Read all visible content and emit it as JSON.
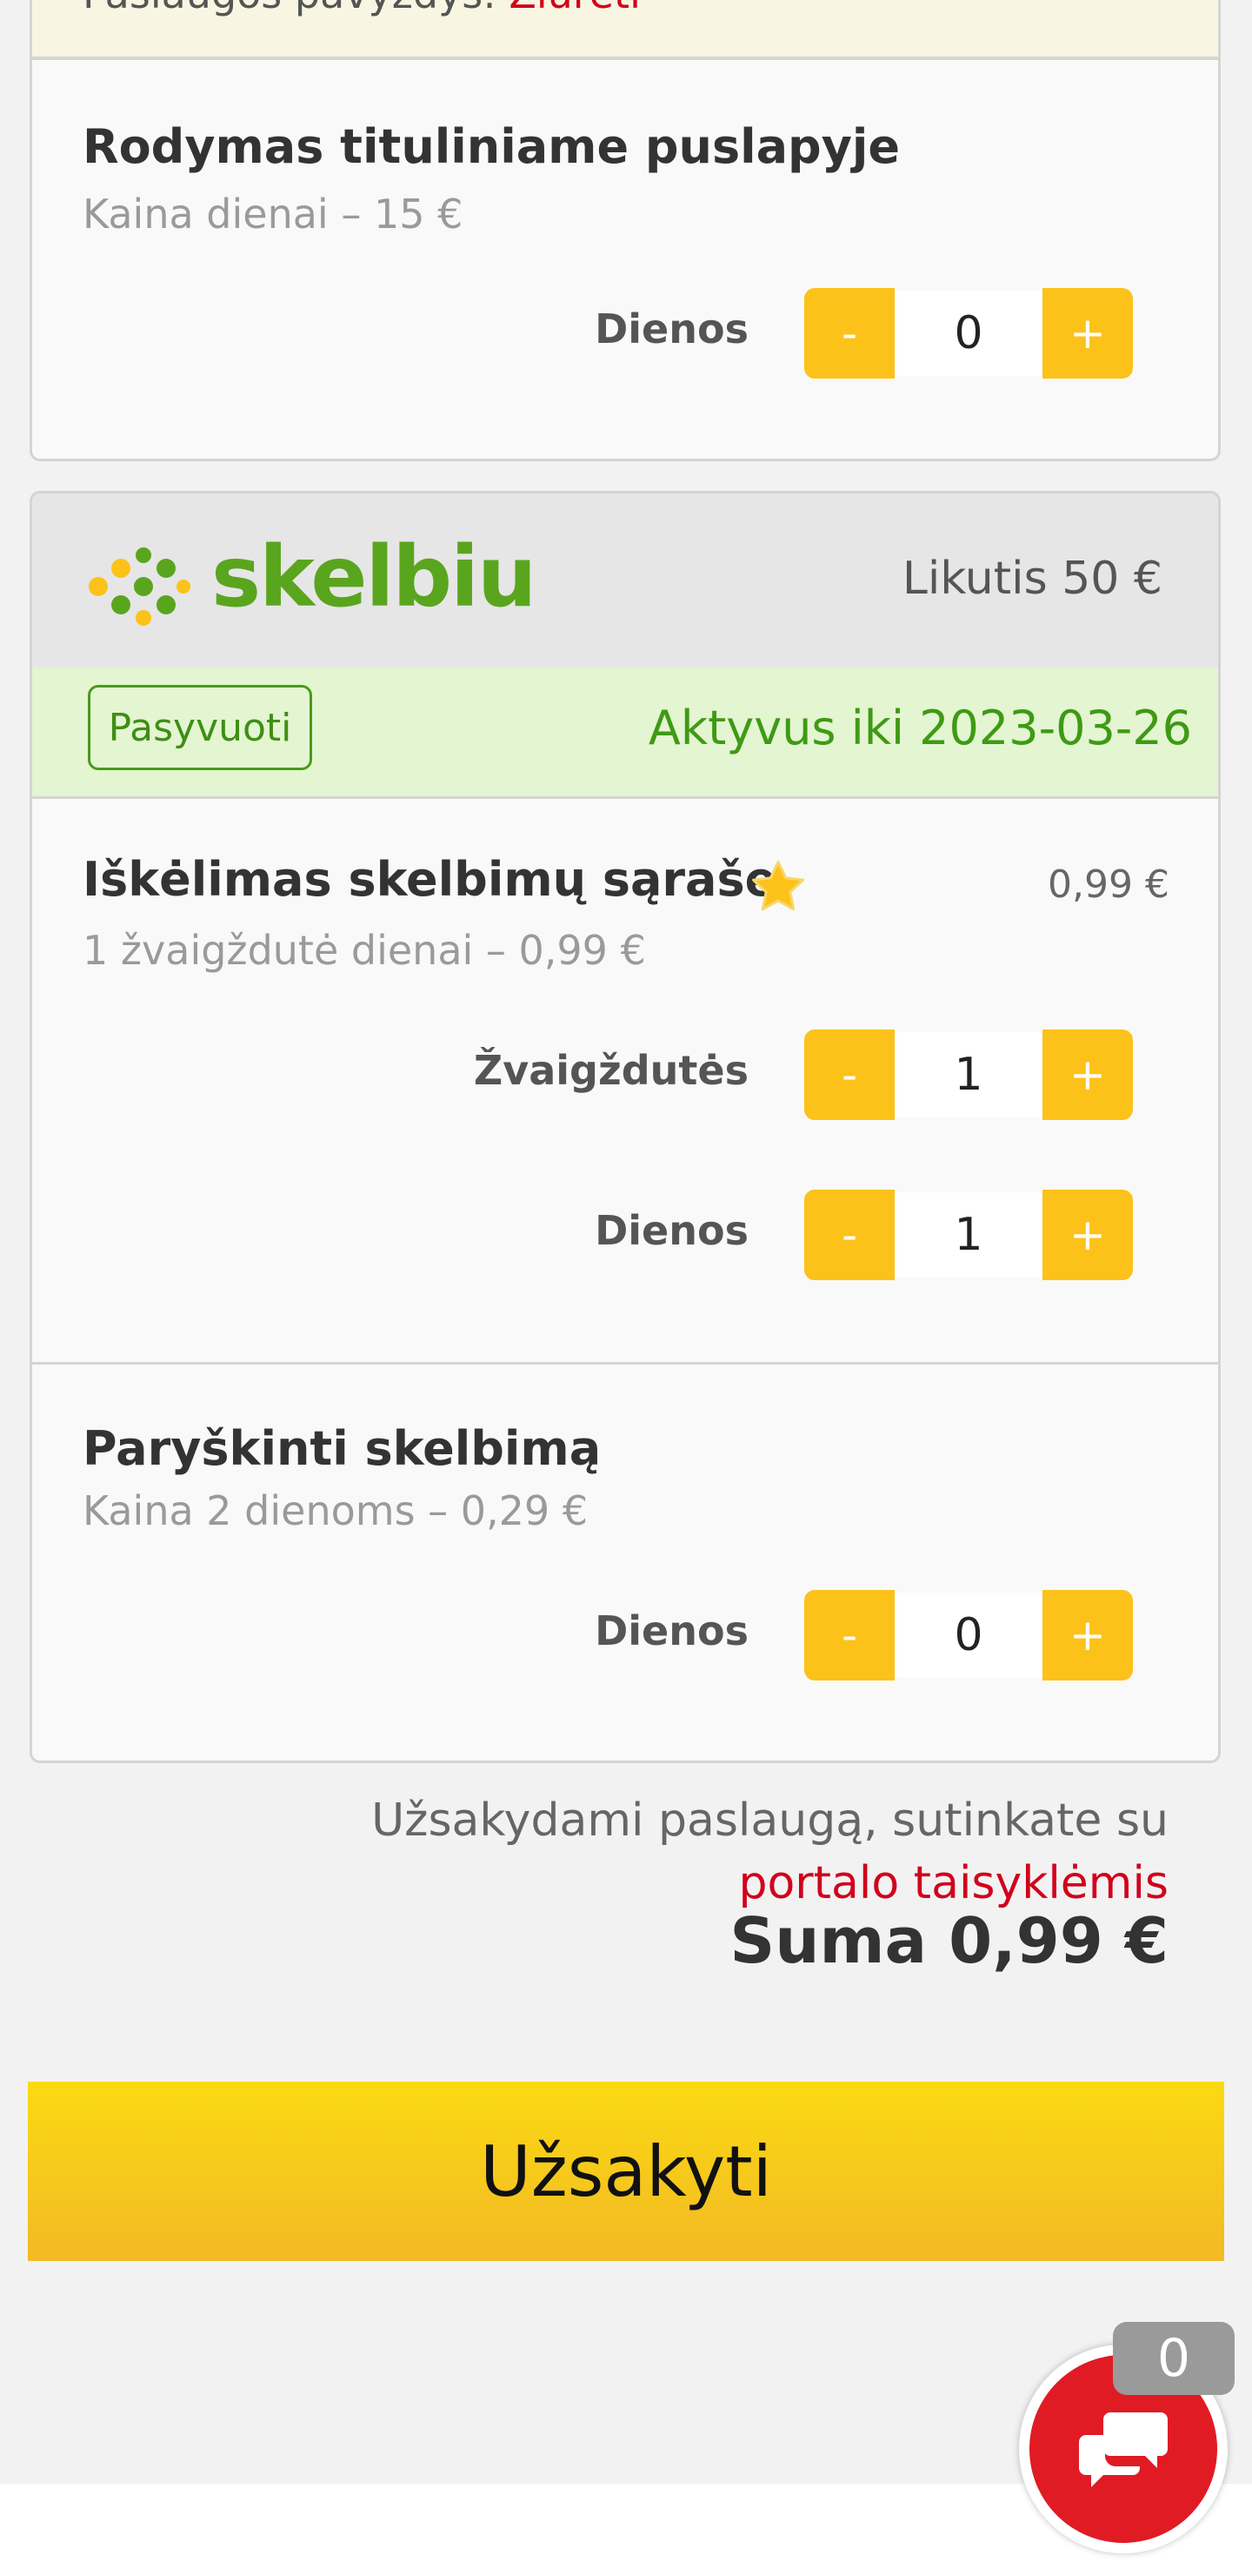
{
  "top_strip": {
    "text": "Paslaugos pavyzdys:",
    "link": "Žiūrėti"
  },
  "homepage_service": {
    "title": "Rodymas tituliniame puslapyje",
    "subtitle": "Kaina dienai – 15 €",
    "days_label": "Dienos",
    "days_value": "0"
  },
  "brand": {
    "name": "skelbiu",
    "balance": "Likutis 50 €"
  },
  "status": {
    "deactivate_label": "Pasyvuoti",
    "active_until": "Aktyvus iki 2023-03-26"
  },
  "highlight_service": {
    "title": "Iškėlimas skelbimų sąraše",
    "price": "0,99 €",
    "subtitle": "1 žvaigždutė dienai – 0,99 €",
    "stars_label": "Žvaigždutės",
    "stars_value": "1",
    "days_label": "Dienos",
    "days_value": "1"
  },
  "bold_service": {
    "title": "Paryškinti skelbimą",
    "subtitle": "Kaina 2 dienoms – 0,29 €",
    "days_label": "Dienos",
    "days_value": "0"
  },
  "stepper": {
    "minus": "-",
    "plus": "+"
  },
  "terms": {
    "text": "Užsakydami paslaugą, sutinkate su",
    "link": "portalo taisyklėmis"
  },
  "total": "Suma 0,99 €",
  "order_button": "Užsakyti",
  "chat": {
    "badge": "0"
  },
  "colors": {
    "accent": "#fcc219",
    "brand_green": "#5aa51e",
    "link_red": "#d0021b",
    "chat_red": "#e01b24"
  }
}
